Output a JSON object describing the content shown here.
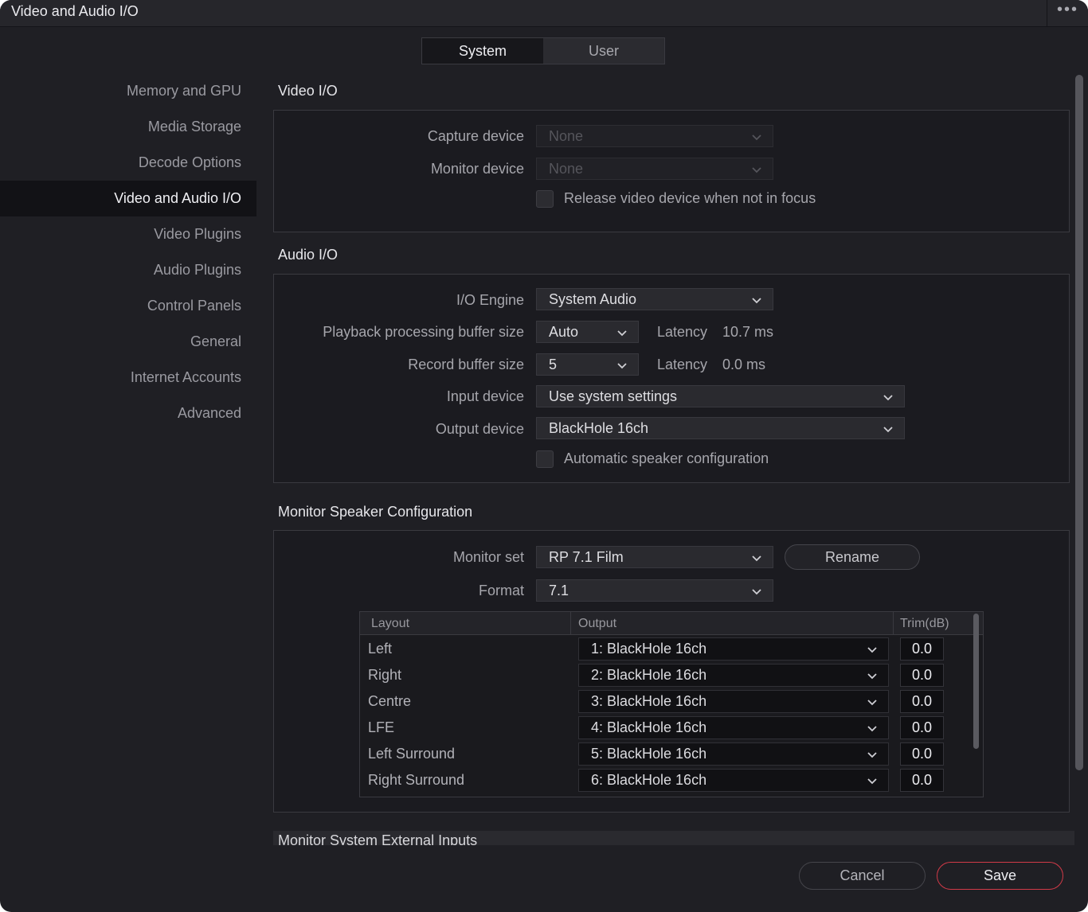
{
  "window": {
    "title": "Video and Audio I/O",
    "more_label": "•••"
  },
  "tabs": [
    {
      "label": "System",
      "active": true
    },
    {
      "label": "User",
      "active": false
    }
  ],
  "sidebar": {
    "items": [
      {
        "label": "Memory and GPU"
      },
      {
        "label": "Media Storage"
      },
      {
        "label": "Decode Options"
      },
      {
        "label": "Video and Audio I/O",
        "active": true
      },
      {
        "label": "Video Plugins"
      },
      {
        "label": "Audio Plugins"
      },
      {
        "label": "Control Panels"
      },
      {
        "label": "General"
      },
      {
        "label": "Internet Accounts"
      },
      {
        "label": "Advanced"
      }
    ]
  },
  "video_io": {
    "title": "Video I/O",
    "capture_label": "Capture device",
    "capture_value": "None",
    "monitor_label": "Monitor device",
    "monitor_value": "None",
    "release_label": "Release video device when not in focus",
    "release_checked": false
  },
  "audio_io": {
    "title": "Audio I/O",
    "engine_label": "I/O Engine",
    "engine_value": "System Audio",
    "playback_label": "Playback processing buffer size",
    "playback_value": "Auto",
    "playback_latency_label": "Latency",
    "playback_latency_value": "10.7 ms",
    "record_label": "Record buffer size",
    "record_value": "5",
    "record_latency_label": "Latency",
    "record_latency_value": "0.0 ms",
    "input_label": "Input device",
    "input_value": "Use system settings",
    "output_label": "Output device",
    "output_value": "BlackHole 16ch",
    "auto_label": "Automatic speaker configuration",
    "auto_checked": false
  },
  "monitor_speaker": {
    "title": "Monitor Speaker Configuration",
    "set_label": "Monitor set",
    "set_value": "RP 7.1 Film",
    "rename_label": "Rename",
    "format_label": "Format",
    "format_value": "7.1",
    "table": {
      "headers": {
        "layout": "Layout",
        "output": "Output",
        "trim": "Trim(dB)"
      },
      "rows": [
        {
          "layout": "Left",
          "output": "1: BlackHole 16ch",
          "trim": "0.0"
        },
        {
          "layout": "Right",
          "output": "2: BlackHole 16ch",
          "trim": "0.0"
        },
        {
          "layout": "Centre",
          "output": "3: BlackHole 16ch",
          "trim": "0.0"
        },
        {
          "layout": "LFE",
          "output": "4: BlackHole 16ch",
          "trim": "0.0"
        },
        {
          "layout": "Left Surround",
          "output": "5: BlackHole 16ch",
          "trim": "0.0"
        },
        {
          "layout": "Right Surround",
          "output": "6: BlackHole 16ch",
          "trim": "0.0"
        }
      ]
    }
  },
  "external_inputs_title": "Monitor System External Inputs",
  "footer": {
    "cancel_label": "Cancel",
    "save_label": "Save"
  },
  "colors": {
    "background": "#1f1f24",
    "accent_save_border": "#d23a48"
  }
}
